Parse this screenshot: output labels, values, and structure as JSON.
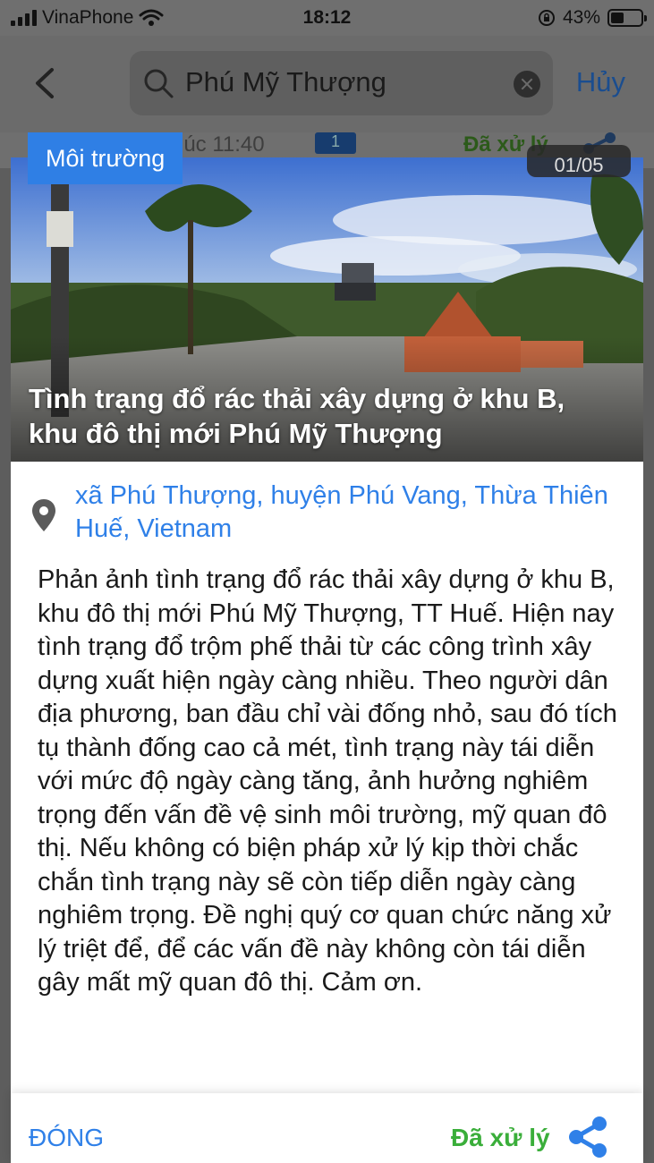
{
  "status_bar": {
    "carrier": "VinaPhone",
    "time": "18:12",
    "battery_percent": "43%",
    "battery_level": 0.43,
    "icons": [
      "signal-icon",
      "wifi-icon",
      "orientation-lock-icon",
      "battery-icon"
    ]
  },
  "search": {
    "query": "Phú Mỹ Thượng",
    "cancel_label": "Hủy"
  },
  "background_row": {
    "time_text": "lúc 11:40",
    "comment_count": "1",
    "status": "Đã xử lý"
  },
  "report": {
    "category": "Môi trường",
    "page_counter": "01/05",
    "title": "Tình trạng đổ rác thải xây dựng ở khu B, khu đô thị mới Phú Mỹ Thượng",
    "location": "xã Phú Thượng, huyện Phú Vang, Thừa Thiên Huế, Vietnam",
    "description": "Phản ảnh tình trạng đổ rác thải xây dựng ở khu B, khu đô thị mới Phú Mỹ Thượng, TT Huế. Hiện nay tình trạng đổ trộm phế thải từ các công trình xây dựng xuất hiện ngày càng nhiều. Theo người dân địa phương, ban đầu chỉ vài đống nhỏ, sau đó tích tụ thành đống cao cả mét, tình trạng này tái diễn với mức độ ngày càng tăng, ảnh hưởng nghiêm trọng đến vấn đề vệ sinh môi trường, mỹ quan đô thị. Nếu không có biện pháp xử lý kịp thời chắc chắn tình trạng này sẽ còn tiếp diễn ngày càng nghiêm trọng. Đề nghị quý cơ quan chức năng xử lý triệt để, để các vấn đề này không còn tái diễn gây mất mỹ quan đô thị. Cảm ơn."
  },
  "actions": {
    "close_label": "ĐÓNG",
    "status_label": "Đã xử lý"
  },
  "colors": {
    "accent_blue": "#2f80e8",
    "category_blue": "#2f7fe5",
    "status_green": "#3aae3a"
  }
}
